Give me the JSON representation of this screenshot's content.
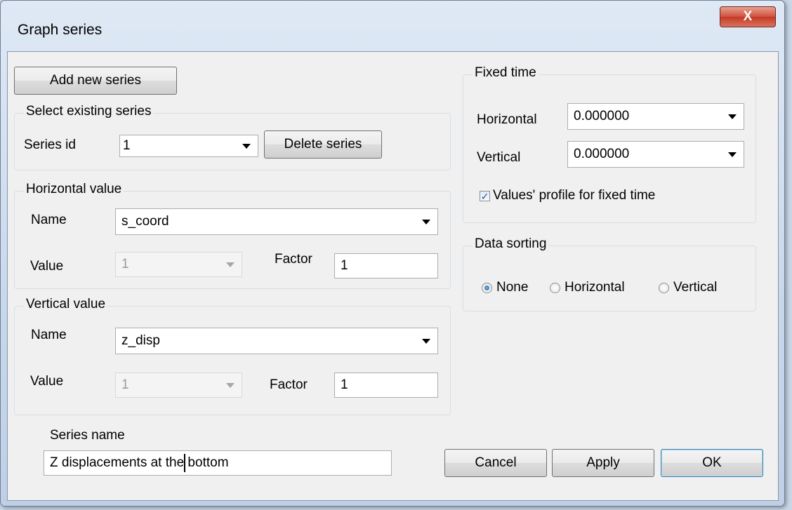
{
  "window": {
    "title": "Graph series",
    "close_glyph": "X"
  },
  "add_series": {
    "label": "Add new series"
  },
  "select_existing": {
    "legend": "Select existing series",
    "series_id_label": "Series id",
    "series_id_value": "1",
    "delete_label": "Delete series"
  },
  "horizontal_value": {
    "legend": "Horizontal value",
    "name_label": "Name",
    "name_value": "s_coord",
    "value_label": "Value",
    "value_value": "1",
    "factor_label": "Factor",
    "factor_value": "1"
  },
  "vertical_value": {
    "legend": "Vertical value",
    "name_label": "Name",
    "name_value": "z_disp",
    "value_label": "Value",
    "value_value": "1",
    "factor_label": "Factor",
    "factor_value": "1"
  },
  "series_name": {
    "label": "Series name",
    "value": "Z displacements at the bottom"
  },
  "fixed_time": {
    "legend": "Fixed time",
    "horizontal_label": "Horizontal",
    "horizontal_value": "0.000000",
    "vertical_label": "Vertical",
    "vertical_value": "0.000000",
    "profile_checkbox_label": "Values' profile for fixed time",
    "profile_checked": true
  },
  "data_sorting": {
    "legend": "Data sorting",
    "options": [
      "None",
      "Horizontal",
      "Vertical"
    ],
    "selected": "None"
  },
  "buttons": {
    "cancel": "Cancel",
    "apply": "Apply",
    "ok": "OK"
  }
}
